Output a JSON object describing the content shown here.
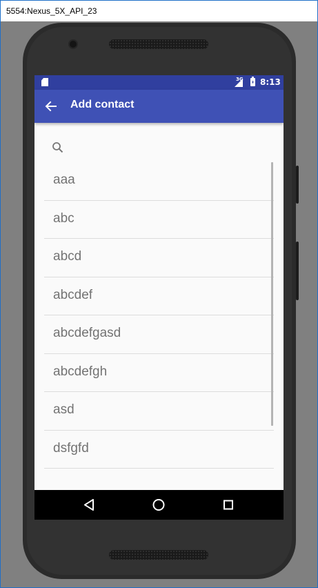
{
  "window": {
    "title": "5554:Nexus_5X_API_23"
  },
  "status_bar": {
    "network_type": "3G",
    "time": "8:13"
  },
  "toolbar": {
    "title": "Add contact"
  },
  "search": {
    "placeholder": "",
    "value": ""
  },
  "contacts": [
    "aaa",
    "abc",
    "abcd",
    "abcdef",
    "abcdefgasd",
    "abcdefgh",
    "asd",
    "dsfgfd"
  ],
  "colors": {
    "status_bar": "#303f9f",
    "toolbar": "#3f51b5",
    "screen_bg": "#fafafa",
    "contact_text": "#737373",
    "emulator_bg": "#808080"
  },
  "icons": {
    "back": "arrow-back-icon",
    "search": "search-icon",
    "nav_back": "triangle-back-icon",
    "nav_home": "circle-home-icon",
    "nav_recents": "square-recents-icon"
  }
}
